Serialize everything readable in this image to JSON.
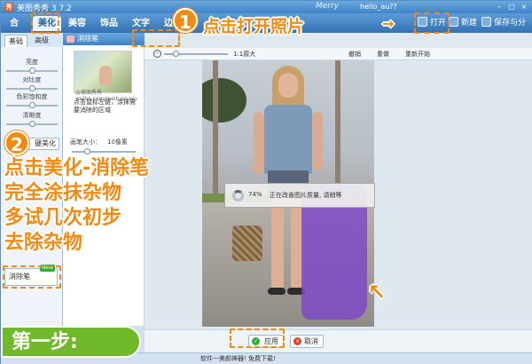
{
  "window": {
    "title": "美图秀秀 3.7.2",
    "brand_text": "Merry",
    "user_text": "hello_au??"
  },
  "nav_tabs": [
    {
      "label": "美化",
      "active": true
    },
    {
      "label": "美容",
      "active": false
    },
    {
      "label": "饰品",
      "active": false
    },
    {
      "label": "文字",
      "active": false
    },
    {
      "label": "边框",
      "active": false
    }
  ],
  "toolbar": {
    "home_label": "合",
    "open_label": "打开",
    "new_label": "新建",
    "save_label": "保存与分享"
  },
  "left_panel": {
    "tabs": [
      "基础",
      "高级"
    ],
    "sliders": [
      {
        "label": "亮度",
        "value": 0.5
      },
      {
        "label": "对比度",
        "value": 0.5
      },
      {
        "label": "色彩饱和度",
        "value": 0.5
      },
      {
        "label": "清晰度",
        "value": 0.5
      }
    ],
    "one_key_label": "键美化",
    "eraser_item_label": "消除笔",
    "new_badge": "New"
  },
  "tool_panel": {
    "title": "消除笔",
    "watermark": "@美图秀秀 weibo.com/meituxiuxiu",
    "hint": "点击鼠标左键，涂抹需要消除的区域",
    "brush_label": "画笔大小：",
    "brush_size": "10像素"
  },
  "canvas": {
    "actual_size_label": "1:1原大",
    "undo_label": "撤销",
    "redo_label": "重做",
    "restart_label": "重新开始",
    "progress_percent": "74%",
    "progress_text": "正在改善图片质量, 请稍等",
    "apply_label": "应用",
    "cancel_label": "取消"
  },
  "status": {
    "text": "软件一美颜神器! 免费下载!"
  },
  "overlays": {
    "step1_number": "1",
    "step1_text": "点击打开照片",
    "step1_arrow": "→",
    "step2_number": "2",
    "step2_text": "点击美化-消除笔\n完全涂抹杂物\n多试几次初步\n去除杂物",
    "step_banner": "第一步:",
    "accent_color": "#f08a12",
    "banner_color": "#6fb92b",
    "erase_color": "#7d46c8"
  }
}
